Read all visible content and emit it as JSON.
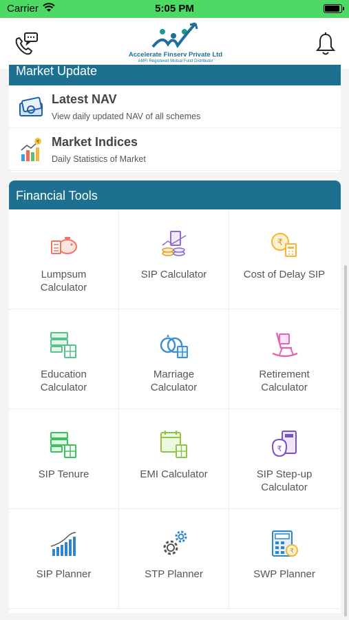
{
  "status_bar": {
    "carrier": "Carrier",
    "time": "5:05 PM",
    "battery_level": 0.95
  },
  "header": {
    "logo_line1": "Accelerate Finserv Private Ltd",
    "logo_line2": "AMFI Registered Mutual Fund Distributor",
    "left_icon": "phone-chat-icon",
    "right_icon": "bell-icon"
  },
  "market_update": {
    "title": "Market Update",
    "items": [
      {
        "title": "Latest NAV",
        "subtitle": "View daily updated NAV of all schemes",
        "icon": "cash-icon"
      },
      {
        "title": "Market Indices",
        "subtitle": "Daily Statistics of Market",
        "icon": "bar-graph-icon"
      }
    ]
  },
  "financial_tools": {
    "title": "Financial Tools",
    "tools": [
      {
        "label": "Lumpsum\nCalculator",
        "icon": "piggy-bank-icon",
        "color": "#f0735e"
      },
      {
        "label": "SIP Calculator",
        "icon": "coins-calculator-icon",
        "color": "#8b6ad1"
      },
      {
        "label": "Cost of Delay SIP",
        "icon": "rupee-coin-calculator-icon",
        "color": "#f2b632"
      },
      {
        "label": "Education\nCalculator",
        "icon": "books-calculator-icon",
        "color": "#56c28a"
      },
      {
        "label": "Marriage\nCalculator",
        "icon": "rings-calculator-icon",
        "color": "#3d8fd1"
      },
      {
        "label": "Retirement\nCalculator",
        "icon": "rocking-chair-icon",
        "color": "#e067b8"
      },
      {
        "label": "SIP Tenure",
        "icon": "books-calculator-icon",
        "color": "#3cc05a"
      },
      {
        "label": "EMI Calculator",
        "icon": "calendar-calculator-icon",
        "color": "#8cc63f"
      },
      {
        "label": "SIP Step-up\nCalculator",
        "icon": "money-bag-calculator-icon",
        "color": "#7b4fc9"
      },
      {
        "label": "SIP Planner",
        "icon": "growth-chart-icon",
        "color": "#2e86c8"
      },
      {
        "label": "STP Planner",
        "icon": "gears-icon",
        "color": "#2e86c8"
      },
      {
        "label": "SWP Planner",
        "icon": "calculator-rupee-icon",
        "color": "#2e86c8"
      }
    ]
  }
}
